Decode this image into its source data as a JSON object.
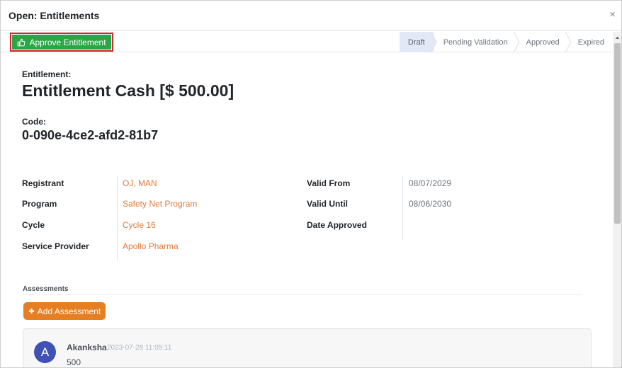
{
  "header": {
    "title": "Open: Entitlements",
    "close_glyph": "×"
  },
  "toolbar": {
    "approve_label": "Approve Entitlement",
    "approve_color": "#28a745",
    "highlight_color": "#d6232f"
  },
  "stages": [
    {
      "label": "Draft",
      "active": true
    },
    {
      "label": "Pending Validation",
      "active": false
    },
    {
      "label": "Approved",
      "active": false
    },
    {
      "label": "Expired",
      "active": false
    }
  ],
  "entitlement": {
    "label": "Entitlement:",
    "name": "Entitlement Cash [$ 500.00]",
    "code_label": "Code:",
    "code": "0-090e-4ce2-afd2-81b7"
  },
  "fields_left": [
    {
      "label": "Registrant",
      "value": "OJ, MAN"
    },
    {
      "label": "Program",
      "value": "Safety Net Program"
    },
    {
      "label": "Cycle",
      "value": "Cycle 16"
    },
    {
      "label": "Service Provider",
      "value": "Apollo Pharma"
    }
  ],
  "fields_right": [
    {
      "label": "Valid From",
      "value": "08/07/2029"
    },
    {
      "label": "Valid Until",
      "value": "08/06/2030"
    },
    {
      "label": "Date Approved",
      "value": ""
    }
  ],
  "assessments": {
    "section_label": "Assessments",
    "add_label": "Add Assessment",
    "add_color": "#e67e22",
    "items": [
      {
        "avatar": "A",
        "author": "Akanksha",
        "timestamp": "2023-07-28 11:05:11",
        "text": "500"
      }
    ]
  },
  "colors": {
    "link": "#e07b39",
    "avatar": "#3f51b5"
  }
}
